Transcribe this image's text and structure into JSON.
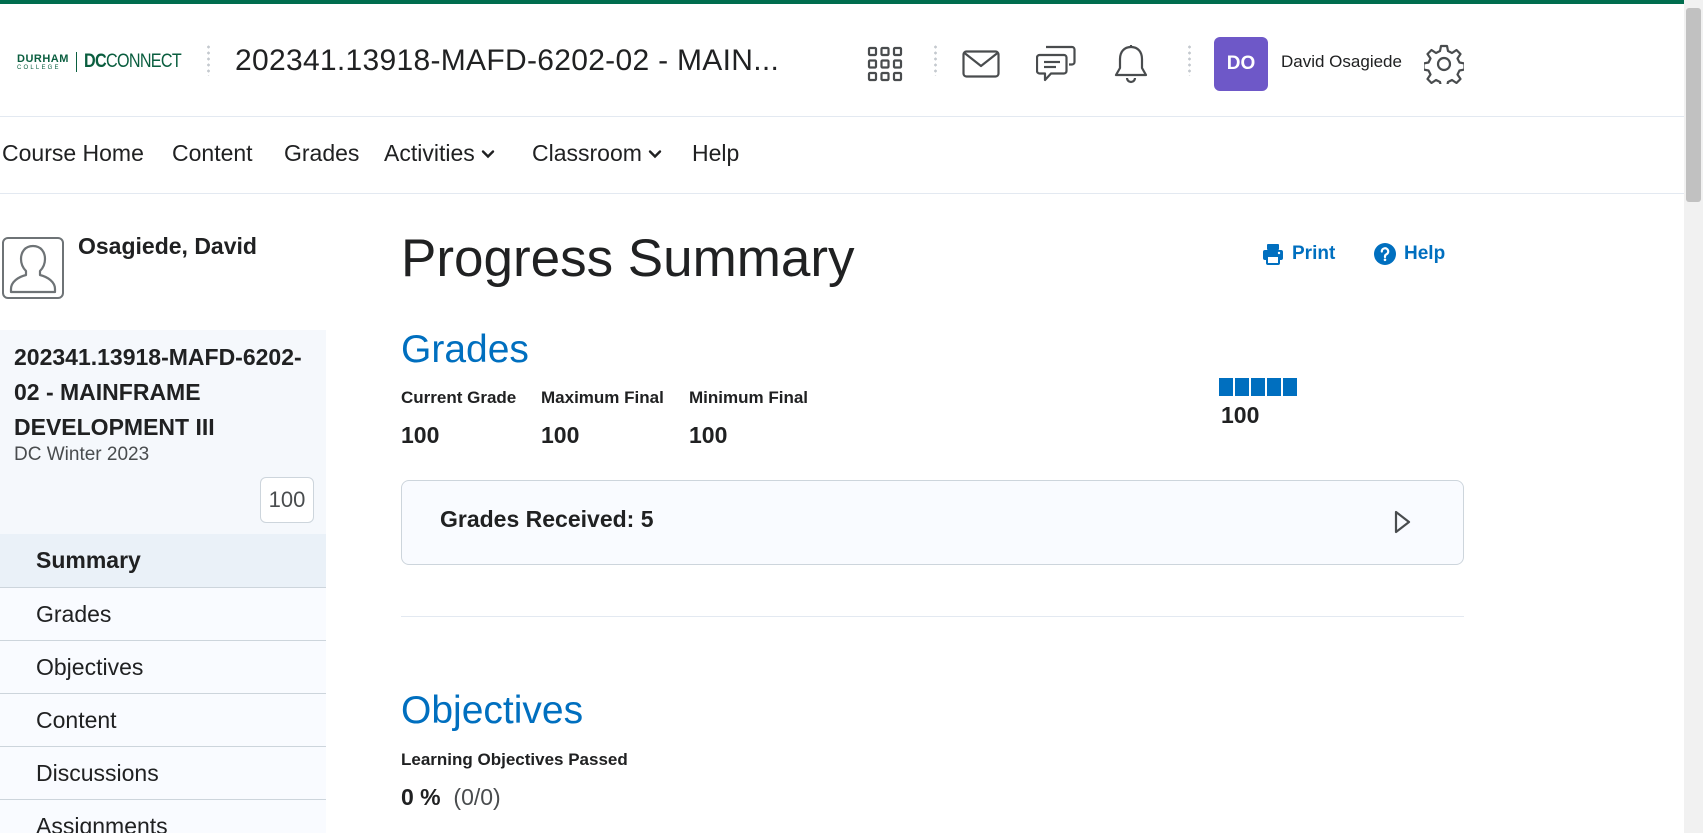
{
  "header": {
    "logo_primary": "DURHAM",
    "logo_secondary": "COLLEGE",
    "logo_brand_a": "DC",
    "logo_brand_b": "CONNECT",
    "course_title": "202341.13918-MAFD-6202-02 - MAIN...",
    "user_initials": "DO",
    "user_name": "David Osagiede",
    "icons": [
      "waffle-grid-icon",
      "email-icon",
      "chat-icon",
      "bell-icon",
      "gear-icon"
    ],
    "accent_color": "#006d4e",
    "avatar_color": "#6e58c8"
  },
  "nav": {
    "items": [
      {
        "label": "Course Home",
        "dropdown": false
      },
      {
        "label": "Content",
        "dropdown": false
      },
      {
        "label": "Grades",
        "dropdown": false
      },
      {
        "label": "Activities",
        "dropdown": true
      },
      {
        "label": "Classroom",
        "dropdown": true
      },
      {
        "label": "Help",
        "dropdown": false
      }
    ]
  },
  "sidebar": {
    "profile_name": "Osagiede, David",
    "course_name": "202341.13918-MAFD-6202-02 - MAINFRAME DEVELOPMENT III",
    "course_term": "DC Winter 2023",
    "course_grade": "100",
    "items": [
      {
        "label": "Summary",
        "active": true
      },
      {
        "label": "Grades",
        "active": false
      },
      {
        "label": "Objectives",
        "active": false
      },
      {
        "label": "Content",
        "active": false
      },
      {
        "label": "Discussions",
        "active": false
      },
      {
        "label": "Assignments",
        "active": false
      }
    ]
  },
  "main": {
    "title": "Progress Summary",
    "print_label": "Print",
    "help_label": "Help",
    "link_color": "#006fbf",
    "grades": {
      "heading": "Grades",
      "current_label": "Current Grade",
      "current_value": "100",
      "max_label": "Maximum Final",
      "max_value": "100",
      "min_label": "Minimum Final",
      "min_value": "100",
      "bar_fill_fraction": 1.0,
      "bar_value": "100",
      "received_label": "Grades Received: 5"
    },
    "objectives": {
      "heading": "Objectives",
      "passed_label": "Learning Objectives Passed",
      "passed_percent": "0 %",
      "passed_count": "(0/0)"
    }
  }
}
